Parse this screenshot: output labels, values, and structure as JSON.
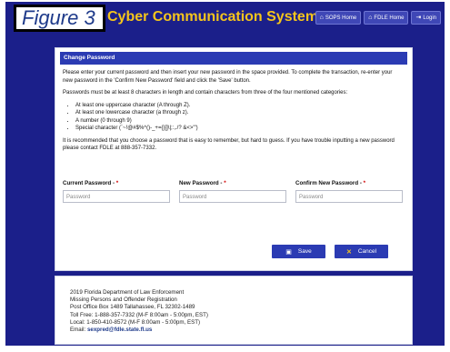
{
  "figure_label": "Figure 3",
  "app_title": "Cyber Communication System",
  "nav": {
    "sops_home": "SOPS Home",
    "fdle_home": "FDLE Home",
    "login": "Login"
  },
  "card": {
    "header": "Change Password",
    "intro": "Please enter your current password and then insert your new password in the space provided. To complete the transaction, re-enter your new password in the 'Confirm New Password' field and click the 'Save' button.",
    "rules_intro": "Passwords must be at least 8 characters in length and contain characters from three of the four mentioned categories:",
    "rules": [
      "At least one uppercase character (A through Z).",
      "At least one lowercase character (a through z).",
      "A number (0 through 9)",
      "Special character (`~!@#$%^()-_+={}[]\\|;:,./? &<>'\")"
    ],
    "recommend": "It is recommended that you choose a password that is easy to remember, but hard to guess. If you have trouble inputting a new password please contact FDLE at 888-357-7332.",
    "fields": {
      "current_label": "Current Password",
      "new_label": "New Password",
      "confirm_label": "Confirm New Password",
      "required_mark": "*",
      "placeholder": "Password"
    },
    "save": "Save",
    "cancel": "Cancel"
  },
  "footer": {
    "copyright": "2019 Florida Department of Law Enforcement",
    "unit": "Missing Persons and Offender Registration",
    "address": "Post Office Box 1489 Tallahassee, FL 32302-1489",
    "tollfree": "Toll Free: 1-888-357-7332 (M-F 8:00am - 5:00pm, EST)",
    "local": "Local: 1-850-410-8572 (M-F 8:00am - 5:00pm, EST)",
    "email_label": "Email:",
    "email": "sexpred@fdle.state.fl.us"
  },
  "colors": {
    "background": "#1b1f8a",
    "title": "#f4c51c",
    "header": "#2b3bb3"
  }
}
